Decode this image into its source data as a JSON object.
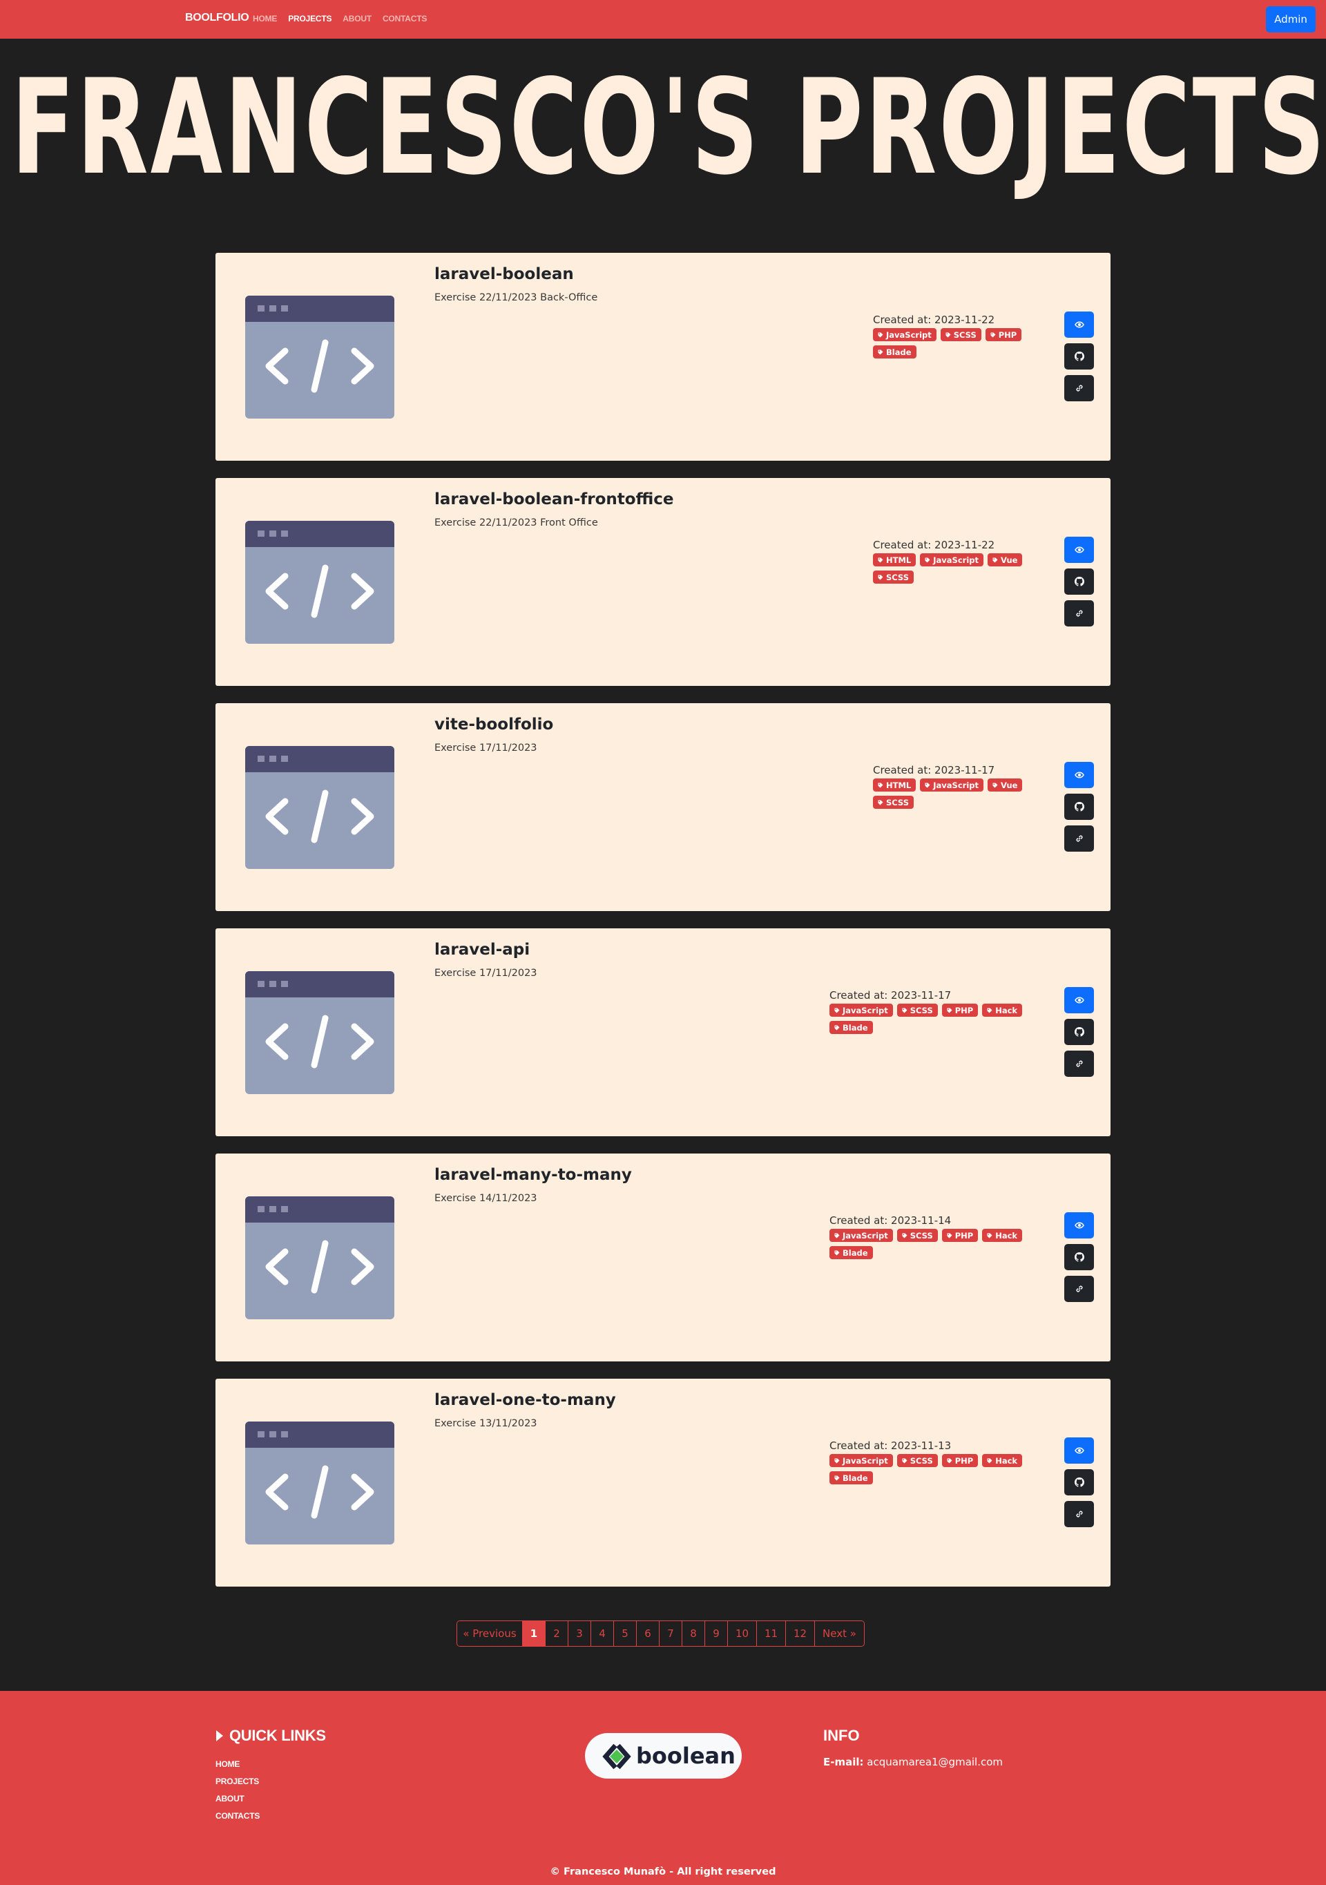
{
  "nav": {
    "brand": "BOOLFOLIO",
    "links": [
      {
        "label": "HOME",
        "active": false
      },
      {
        "label": "PROJECTS",
        "active": true
      },
      {
        "label": "ABOUT",
        "active": false
      },
      {
        "label": "CONTACTS",
        "active": false
      }
    ],
    "admin_label": "Admin"
  },
  "hero": {
    "title": "FRANCESCO'S PROJECTS"
  },
  "projects": [
    {
      "title": "laravel-boolean",
      "description": "Exercise 22/11/2023 Back-Office",
      "created": "Created at: 2023-11-22",
      "tags": [
        "JavaScript",
        "SCSS",
        "PHP",
        "Blade"
      ]
    },
    {
      "title": "laravel-boolean-frontoffice",
      "description": "Exercise 22/11/2023 Front Office",
      "created": "Created at: 2023-11-22",
      "tags": [
        "HTML",
        "JavaScript",
        "Vue",
        "SCSS"
      ]
    },
    {
      "title": "vite-boolfolio",
      "description": "Exercise 17/11/2023",
      "created": "Created at: 2023-11-17",
      "tags": [
        "HTML",
        "JavaScript",
        "Vue",
        "SCSS"
      ]
    },
    {
      "title": "laravel-api",
      "description": "Exercise 17/11/2023",
      "created": "Created at: 2023-11-17",
      "tags": [
        "JavaScript",
        "SCSS",
        "PHP",
        "Hack",
        "Blade"
      ]
    },
    {
      "title": "laravel-many-to-many",
      "description": "Exercise 14/11/2023",
      "created": "Created at: 2023-11-14",
      "tags": [
        "JavaScript",
        "SCSS",
        "PHP",
        "Hack",
        "Blade"
      ]
    },
    {
      "title": "laravel-one-to-many",
      "description": "Exercise 13/11/2023",
      "created": "Created at: 2023-11-13",
      "tags": [
        "JavaScript",
        "SCSS",
        "PHP",
        "Hack",
        "Blade"
      ]
    }
  ],
  "pagination": {
    "items": [
      "« Previous",
      "1",
      "2",
      "3",
      "4",
      "5",
      "6",
      "7",
      "8",
      "9",
      "10",
      "11",
      "12",
      "Next »"
    ],
    "current": "1"
  },
  "footer": {
    "quick_links_title": "QUICK LINKS",
    "quick_links": [
      "HOME",
      "PROJECTS",
      "ABOUT",
      "CONTACTS"
    ],
    "logo_text": "boolean",
    "info_title": "INFO",
    "email_label": "E-mail:",
    "email": "acquamarea1@gmail.com",
    "copyright": "© Francesco Munafò - All right reserved"
  },
  "icons": {
    "view": "eye-icon",
    "github": "github-icon",
    "link": "link-icon",
    "tag": "tag-icon",
    "quick_links": "caret-right-icon",
    "thumbnail": "code-window-icon"
  },
  "colors": {
    "navbar": "#df4343",
    "page_bg": "#1f1f1f",
    "card_bg": "#feeedd",
    "hero_text": "#ffeede",
    "tag_bg": "#d9403f",
    "primary_button": "#0d6efd",
    "dark_button": "#212529"
  }
}
